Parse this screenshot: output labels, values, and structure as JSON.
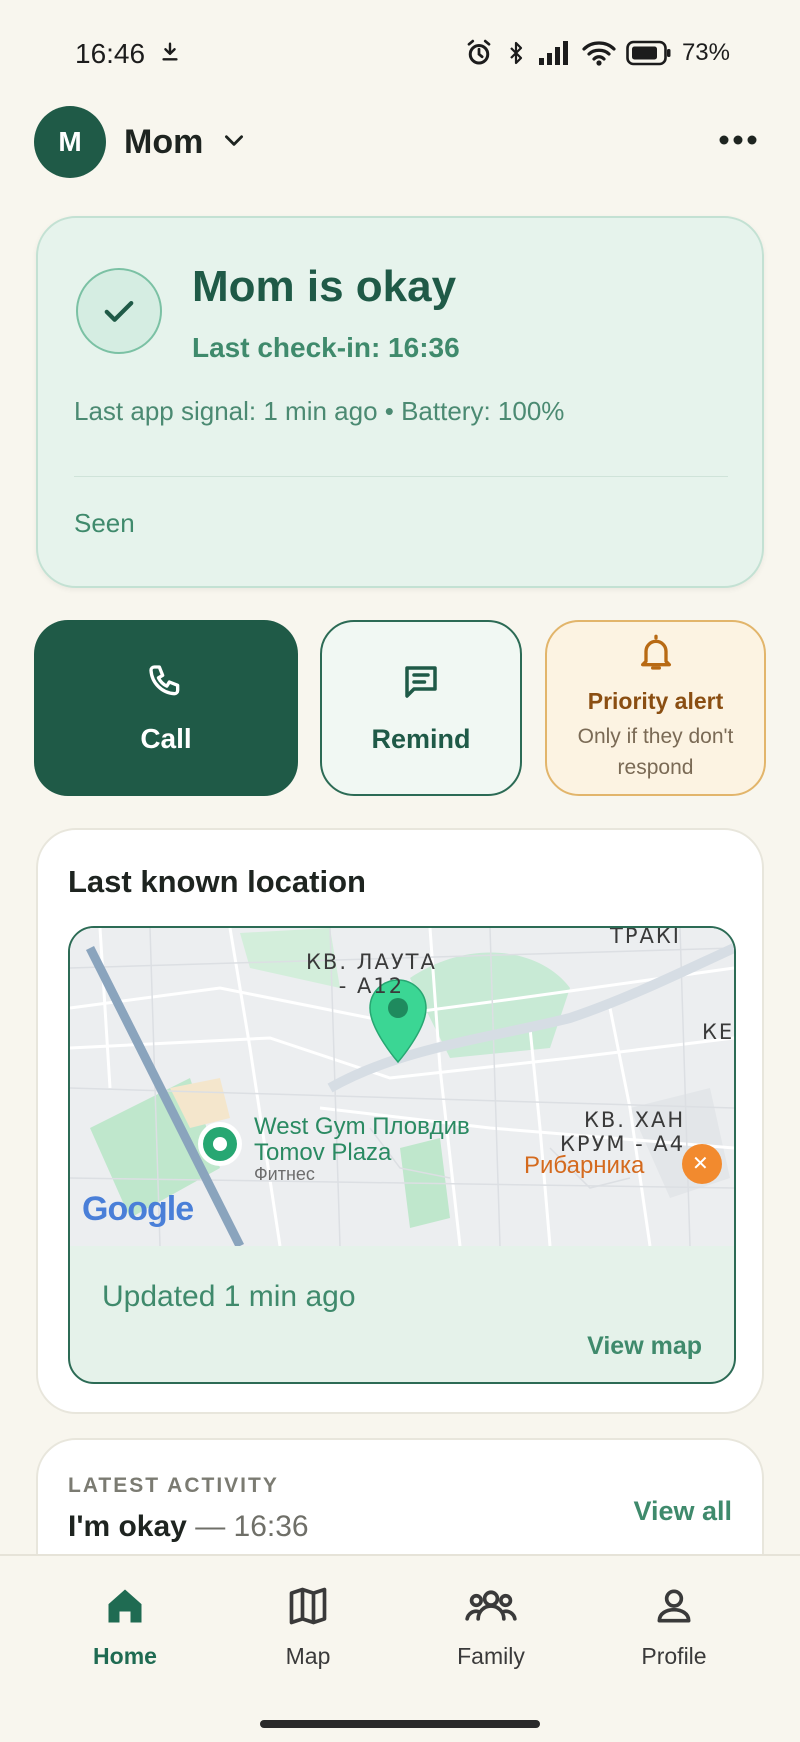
{
  "status_bar": {
    "time": "16:46",
    "battery": "73%"
  },
  "header": {
    "avatar_initial": "M",
    "name": "Mom"
  },
  "status_card": {
    "title": "Mom is okay",
    "last_checkin": "Last check-in: 16:36",
    "meta": "Last app signal: 1 min ago • Battery: 100%",
    "seen": "Seen"
  },
  "actions": {
    "call_label": "Call",
    "remind_label": "Remind",
    "priority_label": "Priority alert",
    "priority_sub": "Only if they don't respond"
  },
  "location": {
    "title": "Last known location",
    "map_labels": {
      "district_1_line1": "КВ. ЛАУТА",
      "district_1_line2": "- А12",
      "district_2_line1": "КВ. ХАН",
      "district_2_line2": "КРУМ - А4",
      "top_right": "ТРАКІ",
      "edge_right": "КЕ",
      "poi_name_line1": "West Gym Пловдив",
      "poi_name_line2": "Tomov Plaza",
      "poi_type": "Фитнес",
      "restaurant": "Рибарника",
      "google": "Google"
    },
    "updated": "Updated 1 min ago",
    "view_map": "View map"
  },
  "activity": {
    "kicker": "LATEST ACTIVITY",
    "event": "I'm okay",
    "time": "— 16:36",
    "view_all": "View all"
  },
  "nav": {
    "items": [
      {
        "label": "Home",
        "icon": "home-icon"
      },
      {
        "label": "Map",
        "icon": "map-icon"
      },
      {
        "label": "Family",
        "icon": "family-icon"
      },
      {
        "label": "Profile",
        "icon": "profile-icon"
      }
    ],
    "active": "Home"
  },
  "colors": {
    "brand_green": "#1f5a47",
    "accent_green": "#3f8a6c",
    "warning": "#8a4e12",
    "background": "#f8f6ee"
  }
}
